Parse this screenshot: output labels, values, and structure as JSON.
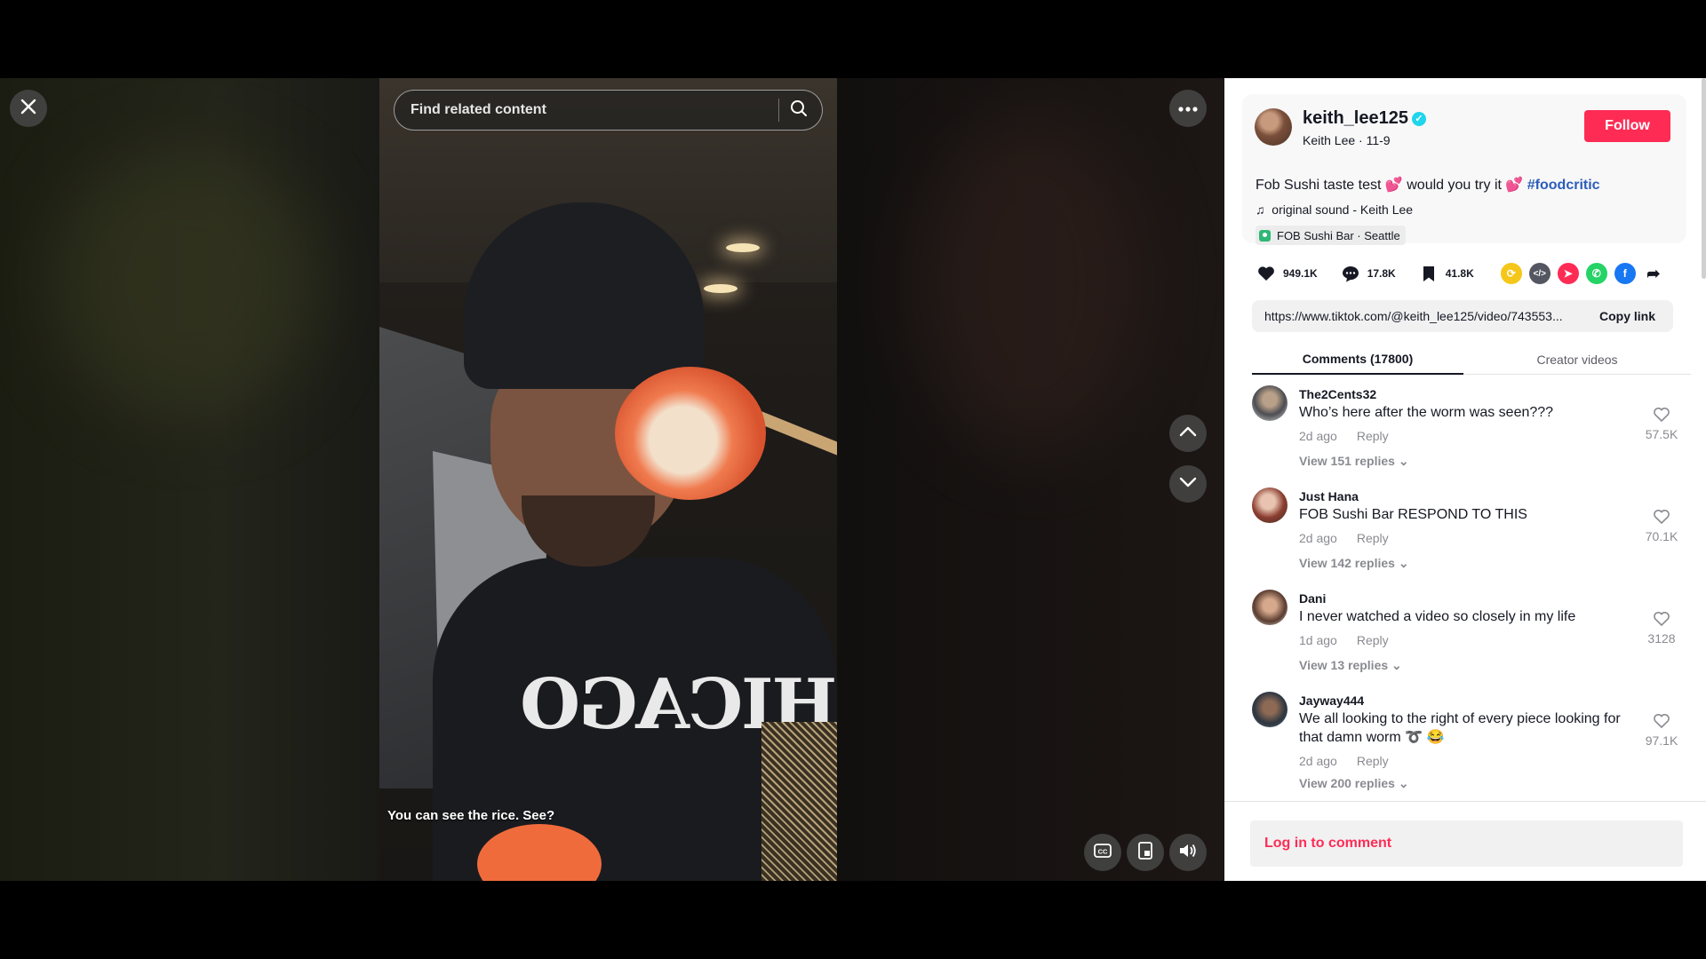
{
  "video": {
    "search_placeholder": "Find related content",
    "caption": "You can see the rice. See?",
    "hoodie_text": "CHICAGO"
  },
  "author": {
    "username": "keith_lee125",
    "display_name_date": "Keith Lee · 11-9",
    "follow_label": "Follow"
  },
  "post": {
    "description": "Fob Sushi taste test",
    "description_mid": "would you try it",
    "hashtag": "#foodcritic",
    "sound": "original sound - Keith Lee",
    "location": "FOB Sushi Bar · Seattle"
  },
  "stats": {
    "likes": "949.1K",
    "comments": "17.8K",
    "saves": "41.8K"
  },
  "share_icons": [
    "repost-icon",
    "embed-icon",
    "send-icon",
    "whatsapp-icon",
    "facebook-icon",
    "share-arrow-icon"
  ],
  "link": {
    "url": "https://www.tiktok.com/@keith_lee125/video/743553...",
    "copy_label": "Copy link"
  },
  "tabs": {
    "comments": "Comments (17800)",
    "creator_videos": "Creator videos"
  },
  "comments": [
    {
      "user": "The2Cents32",
      "text": "Who’s here after the worm was seen???",
      "time": "2d ago",
      "reply": "Reply",
      "view_replies": "View 151 replies",
      "likes": "57.5K"
    },
    {
      "user": "Just Hana",
      "text": "FOB Sushi Bar RESPOND TO THIS",
      "time": "2d ago",
      "reply": "Reply",
      "view_replies": "View 142 replies",
      "likes": "70.1K"
    },
    {
      "user": "Dani",
      "text": "I never watched a video so closely in my life",
      "time": "1d ago",
      "reply": "Reply",
      "view_replies": "View 13 replies",
      "likes": "3128"
    },
    {
      "user": "Jayway444",
      "text": "We all looking to the right of every piece looking for that damn worm",
      "time": "2d ago",
      "reply": "Reply",
      "view_replies": "View 200 replies",
      "likes": "97.1K"
    }
  ],
  "login_prompt": "Log in to comment",
  "colors": {
    "accent": "#fe2c55",
    "hashtag": "#2b5db9",
    "verified": "#20d5ec"
  }
}
